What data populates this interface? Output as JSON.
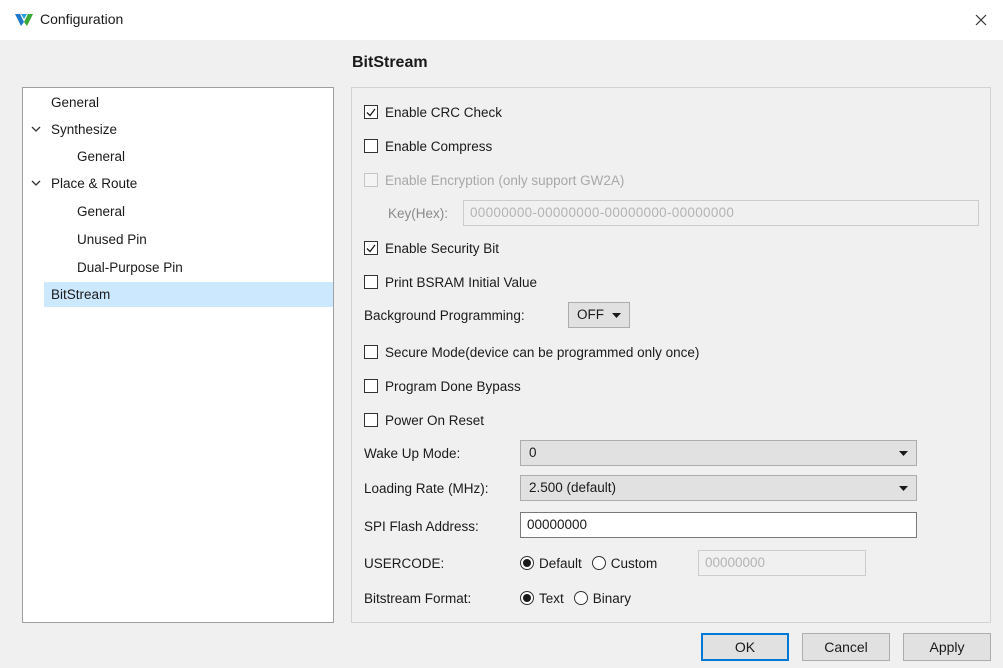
{
  "window": {
    "title": "Configuration",
    "icon": "gowin-logo-icon",
    "close_icon": "close-icon"
  },
  "nav": {
    "items": [
      {
        "label": "General",
        "level": 0,
        "expandable": false
      },
      {
        "label": "Synthesize",
        "level": 0,
        "expandable": true,
        "expanded": true
      },
      {
        "label": "General",
        "level": 1,
        "expandable": false
      },
      {
        "label": "Place & Route",
        "level": 0,
        "expandable": true,
        "expanded": true
      },
      {
        "label": "General",
        "level": 1,
        "expandable": false
      },
      {
        "label": "Unused Pin",
        "level": 1,
        "expandable": false
      },
      {
        "label": "Dual-Purpose Pin",
        "level": 1,
        "expandable": false
      },
      {
        "label": "BitStream",
        "level": 0,
        "expandable": false,
        "selected": true
      }
    ]
  },
  "panel": {
    "title": "BitStream",
    "enable_crc": {
      "label": "Enable CRC Check",
      "checked": true
    },
    "enable_compress": {
      "label": "Enable Compress",
      "checked": false
    },
    "enable_encryption": {
      "label": "Enable Encryption (only support GW2A)",
      "checked": false,
      "disabled": true
    },
    "key_hex": {
      "label": "Key(Hex):",
      "value": "00000000-00000000-00000000-00000000"
    },
    "enable_security": {
      "label": "Enable Security Bit",
      "checked": true
    },
    "print_bsram": {
      "label": "Print BSRAM Initial Value",
      "checked": false
    },
    "background_programming": {
      "label": "Background Programming:",
      "value": "OFF"
    },
    "secure_mode": {
      "label": "Secure Mode(device can be programmed only once)",
      "checked": false
    },
    "program_done_bypass": {
      "label": "Program Done Bypass",
      "checked": false
    },
    "power_on_reset": {
      "label": "Power On Reset",
      "checked": false
    },
    "wake_up_mode": {
      "label": "Wake Up Mode:",
      "value": "0"
    },
    "loading_rate": {
      "label": "Loading Rate (MHz):",
      "value": "2.500 (default)"
    },
    "spi_flash_address": {
      "label": "SPI Flash Address:",
      "value": "00000000"
    },
    "usercode": {
      "label": "USERCODE:",
      "options": [
        "Default",
        "Custom"
      ],
      "selected": "Default",
      "custom_value": "00000000"
    },
    "bitstream_format": {
      "label": "Bitstream Format:",
      "options": [
        "Text",
        "Binary"
      ],
      "selected": "Text"
    }
  },
  "buttons": {
    "ok": "OK",
    "cancel": "Cancel",
    "apply": "Apply"
  },
  "colors": {
    "selection": "#cce8ff",
    "default_button_border": "#0078d7",
    "logo_blue": "#1f78c8",
    "logo_green": "#3aa935"
  }
}
